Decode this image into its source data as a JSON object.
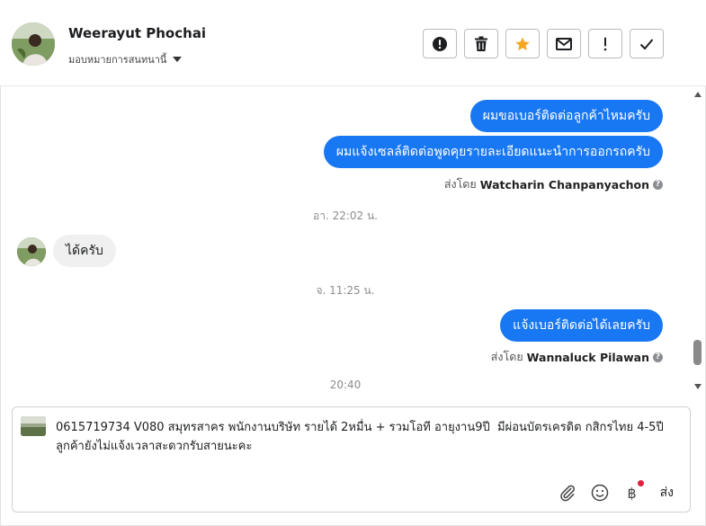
{
  "header": {
    "name": "Weerayut Phochai",
    "assign_label": "มอบหมายการสนทนานี้"
  },
  "actions": [
    {
      "name": "spam-button",
      "icon": "alert-circle-icon"
    },
    {
      "name": "delete-button",
      "icon": "trash-icon"
    },
    {
      "name": "star-button",
      "icon": "star-icon",
      "color": "#f5a623"
    },
    {
      "name": "mark-unread-button",
      "icon": "envelope-icon"
    },
    {
      "name": "follow-up-button",
      "icon": "exclamation-icon"
    },
    {
      "name": "done-button",
      "icon": "checkmark-icon"
    }
  ],
  "messages": {
    "out1": "ผมขอเบอร์ติดต่อลูกค้าไหมครับ",
    "out2": "ผมแจ้งเซลล์ติดต่อพูดคุยรายละเอียดแนะนำการออกรถครับ",
    "sent_by_label": "ส่งโดย",
    "sender1": "Watcharin Chanpanyachon",
    "time1": "อา. 22:02 น.",
    "in1": "ได้ครับ",
    "time2": "จ. 11:25 น.",
    "out3": "แจ้งเบอร์ติดต่อได้เลยครับ",
    "sender2": "Wannaluck Pilawan",
    "time3": "20:40"
  },
  "composer": {
    "text": "0615719734 V080 สมุทรสาคร พนักงานบริษัท รายได้ 2หมื่น + รวมโอที อายุงาน9ปี  มีผ่อนบัตรเครดิต กสิกรไทย 4-5ปี\nลูกค้ายังไม่แจ้งเวลาสะดวกรับสายนะคะ",
    "send_label": "ส่ง",
    "baht_symbol": "฿"
  },
  "colors": {
    "accent": "#1877f2",
    "star": "#f5a623",
    "notification_dot": "#e41e3f"
  }
}
